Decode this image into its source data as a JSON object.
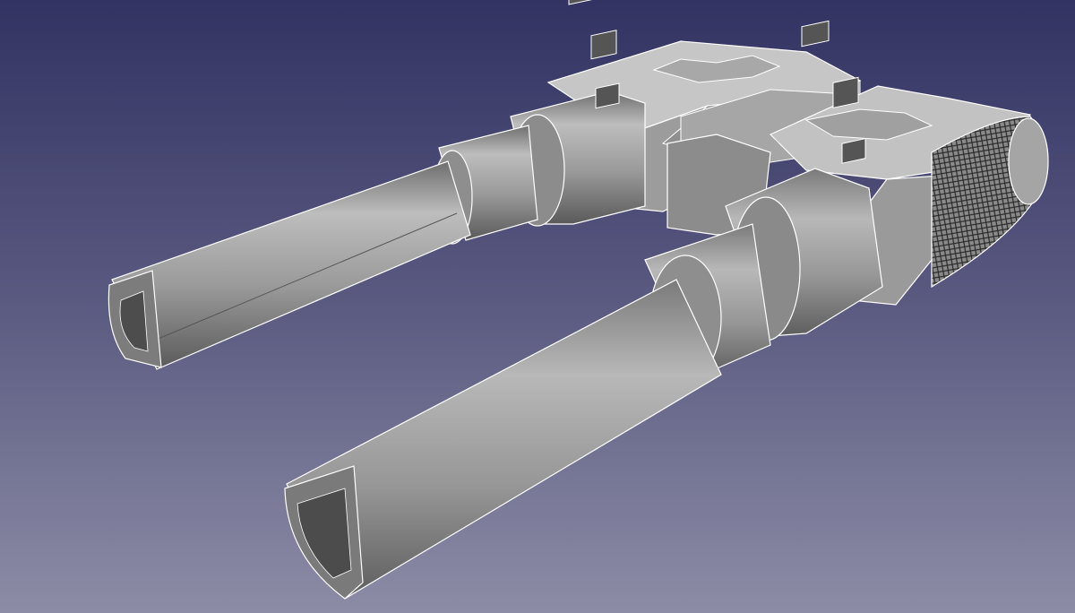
{
  "view": {
    "background_top": "#333363",
    "background_bottom": "#8c8ca6",
    "model_color": "#9e9e9e"
  },
  "parts": [
    {
      "name": "upper-barrel",
      "kind": "cylinder"
    },
    {
      "name": "lower-barrel",
      "kind": "cylinder"
    },
    {
      "name": "knurled-grip",
      "kind": "knurled-cylinder"
    },
    {
      "name": "housing-block",
      "kind": "block"
    }
  ]
}
